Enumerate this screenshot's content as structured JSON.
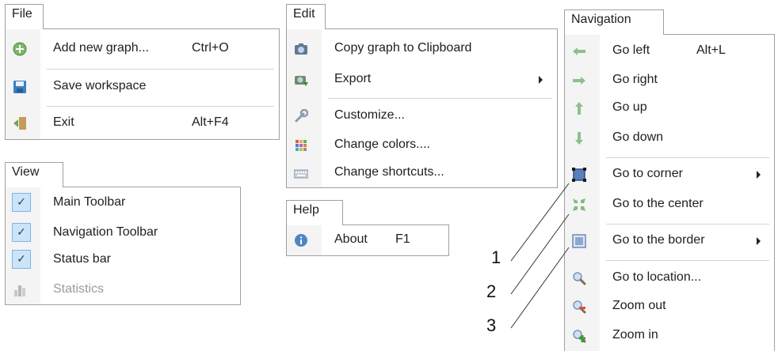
{
  "file_menu": {
    "title": "File",
    "items": [
      {
        "label": "Add new graph...",
        "shortcut": "Ctrl+O",
        "icon": "add-icon"
      },
      {
        "label": "Save workspace",
        "shortcut": "",
        "icon": "floppy-disk-icon"
      },
      {
        "label": "Exit",
        "shortcut": "Alt+F4",
        "icon": "exit-door-icon"
      }
    ]
  },
  "view_menu": {
    "title": "View",
    "items": [
      {
        "label": "Main Toolbar",
        "checked": true
      },
      {
        "label": "Navigation Toolbar",
        "checked": true
      },
      {
        "label": "Status bar",
        "checked": true
      },
      {
        "label": "Statistics",
        "checked": false,
        "disabled": true,
        "icon": "bar-chart-icon"
      }
    ]
  },
  "edit_menu": {
    "title": "Edit",
    "items": [
      {
        "label": "Copy graph to Clipboard",
        "icon": "camera-icon"
      },
      {
        "label": "Export",
        "icon": "export-camera-icon",
        "submenu": true
      },
      {
        "label": "Customize...",
        "icon": "wrench-icon"
      },
      {
        "label": "Change colors....",
        "icon": "color-palette-icon"
      },
      {
        "label": "Change shortcuts...",
        "icon": "keyboard-icon"
      }
    ]
  },
  "help_menu": {
    "title": "Help",
    "items": [
      {
        "label": "About",
        "shortcut": "F1",
        "icon": "info-icon"
      }
    ]
  },
  "navigation_menu": {
    "title": "Navigation",
    "items": [
      {
        "label": "Go left",
        "shortcut": "Alt+L",
        "icon": "arrow-left-icon"
      },
      {
        "label": "Go right",
        "icon": "arrow-right-icon"
      },
      {
        "label": "Go up",
        "icon": "arrow-up-icon"
      },
      {
        "label": "Go down",
        "icon": "arrow-down-icon"
      },
      {
        "label": "Go to corner",
        "icon": "corner-square-icon",
        "submenu": true
      },
      {
        "label": "Go to the center",
        "icon": "center-arrows-icon"
      },
      {
        "label": "Go to the border",
        "icon": "border-square-icon",
        "submenu": true
      },
      {
        "label": "Go to location...",
        "icon": "magnifier-icon"
      },
      {
        "label": "Zoom out",
        "icon": "zoom-out-icon"
      },
      {
        "label": "Zoom in",
        "icon": "zoom-in-icon"
      }
    ]
  },
  "callouts": [
    "1",
    "2",
    "3"
  ],
  "colors": {
    "menu_border": "#a0a0a0",
    "separator": "#d4d4d4",
    "check_bg": "#cce4f7",
    "check_border": "#7eb4ea",
    "arrow_green": "#8cc08a",
    "disabled_text": "#9a9a9a"
  }
}
